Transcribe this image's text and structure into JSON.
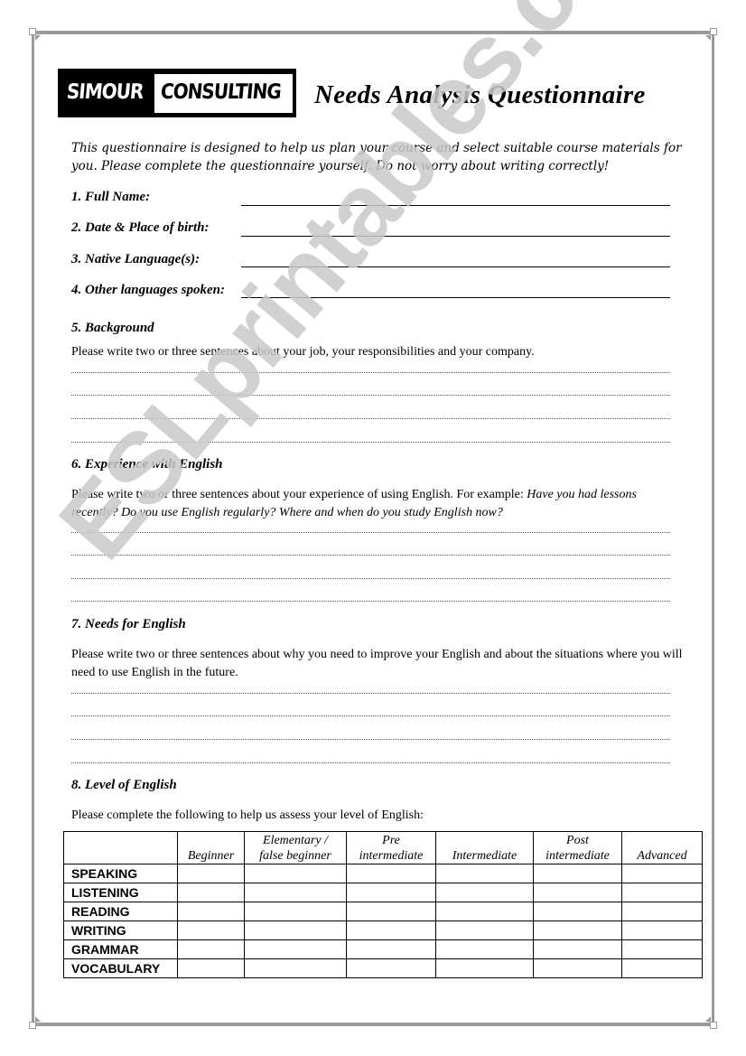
{
  "document": {
    "logo": {
      "left_text": "SIMOUR",
      "right_text": "CONSULTING"
    },
    "title": "Needs Analysis Questionnaire",
    "intro": "This questionnaire is designed to help us plan your course and select suitable course materials for you. Please complete the questionnaire yourself. Do not worry about writing correctly!",
    "fields": [
      {
        "label": "1. Full Name:",
        "value": ""
      },
      {
        "label": "2. Date & Place of birth:",
        "value": ""
      },
      {
        "label": "3. Native Language(s):",
        "value": ""
      },
      {
        "label": "4. Other languages spoken:",
        "value": ""
      }
    ],
    "sections": [
      {
        "heading": "5. Background",
        "prompt": "Please write two  or three sentences about your job, your responsibilities and your company.",
        "prompt_italic": "",
        "answer_lines": 4
      },
      {
        "heading": "6. Experience with English",
        "prompt": "Please write two or three sentences about your experience of using English. For example: ",
        "prompt_italic": "Have you had lessons recently? Do you use English regularly? Where and when do you study English now?",
        "answer_lines": 4
      },
      {
        "heading": "7. Needs for English",
        "prompt": "Please write two or three sentences about why you need to improve your English and about the situations where you will need to use English in the future.",
        "prompt_italic": "",
        "answer_lines": 4
      },
      {
        "heading": "8. Level of English",
        "prompt": "Please complete the following to help us assess your level of English:",
        "prompt_italic": ""
      }
    ],
    "level_table": {
      "columns": [
        {
          "line1": "",
          "line2": ""
        },
        {
          "line1": "",
          "line2": "Beginner"
        },
        {
          "line1": "Elementary /",
          "line2": "false beginner"
        },
        {
          "line1": "Pre",
          "line2": "intermediate"
        },
        {
          "line1": "",
          "line2": "Intermediate"
        },
        {
          "line1": "Post",
          "line2": "intermediate"
        },
        {
          "line1": "",
          "line2": "Advanced"
        }
      ],
      "rows": [
        "SPEAKING",
        "LISTENING",
        "READING",
        "WRITING",
        "GRAMMAR",
        "VOCABULARY"
      ]
    },
    "watermark": "ESLprintables.com",
    "colors": {
      "frame": "#9a9a9a",
      "watermark": "#c9c9c9",
      "logo_bg": "#000000"
    }
  }
}
